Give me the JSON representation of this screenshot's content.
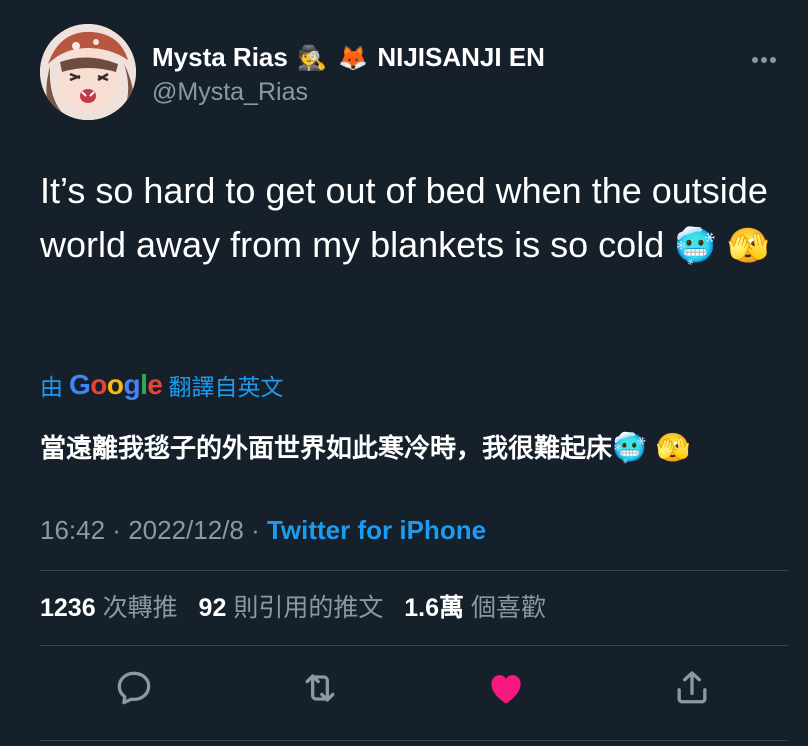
{
  "author": {
    "display_name": "Mysta Rias",
    "name_emojis": [
      "🕵️",
      "🦊"
    ],
    "affiliation": "NIJISANJI EN",
    "handle": "@Mysta_Rias",
    "avatar_icon": "anime-avatar-icon"
  },
  "tweet": {
    "text": "It’s so hard to get out of bed when the outside world away from my blankets is so cold",
    "emojis": "🥶 🫣"
  },
  "translation": {
    "prefix": "由",
    "google_letters": [
      "G",
      "o",
      "o",
      "g",
      "l",
      "e"
    ],
    "suffix": "翻譯自英文",
    "text": "當遠離我毯子的外面世界如此寒冷時，我很難起床",
    "emojis": "🥶 🫣"
  },
  "meta": {
    "time": "16:42",
    "sep1": " · ",
    "date": "2022/12/8",
    "sep2": " · ",
    "source": "Twitter for iPhone"
  },
  "stats": {
    "retweets_num": "1236",
    "retweets_label": "次轉推",
    "quotes_num": "92",
    "quotes_label": "則引用的推文",
    "likes_num": "1.6萬",
    "likes_label": "個喜歡"
  },
  "colors": {
    "background": "#15202b",
    "accent": "#1d9bf0",
    "secondary_text": "#8b98a5",
    "like": "#f91880",
    "divider": "#38444d"
  },
  "actions": {
    "reply_icon": "reply-icon",
    "retweet_icon": "retweet-icon",
    "like_icon": "heart-icon",
    "share_icon": "share-icon",
    "liked": true
  }
}
